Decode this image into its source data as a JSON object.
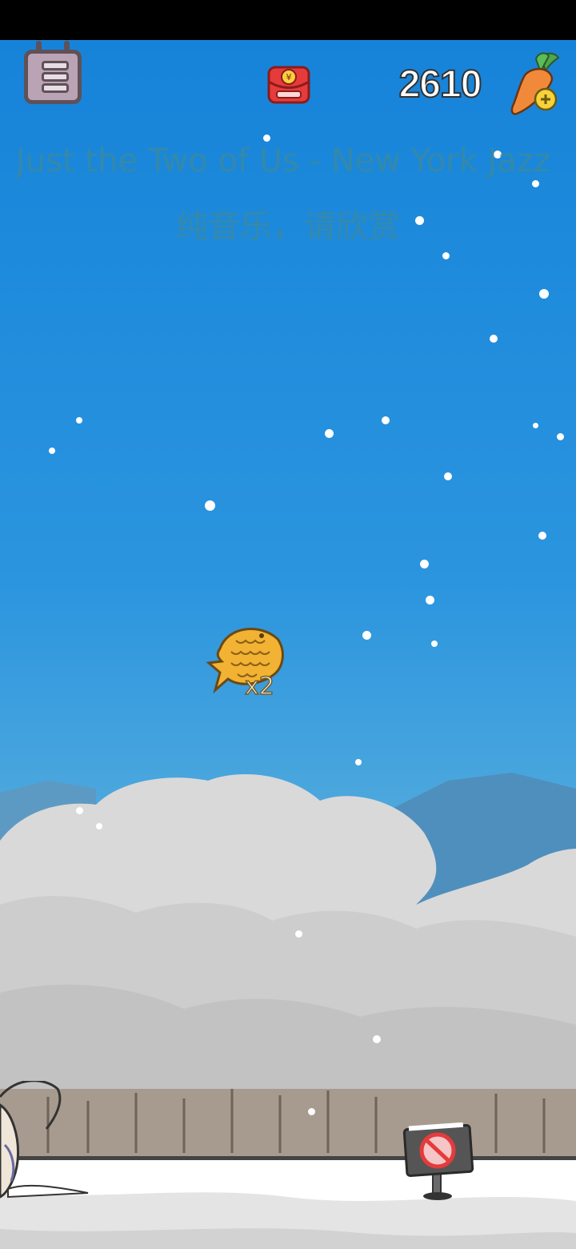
{
  "hud": {
    "menu_icon": "menu-icon",
    "red_envelope_icon": "red-envelope-icon",
    "red_envelope_symbol": "¥",
    "score": "2610",
    "carrot_icon": "carrot-add-icon"
  },
  "music": {
    "title": "Just the Two of Us - New York Jazz",
    "subtitle": "纯音乐，请欣赏"
  },
  "pickup": {
    "icon": "taiyaki-fish-icon",
    "multiplier": "x2"
  },
  "scene": {
    "sign_icon": "no-entry-sign-icon",
    "character_icon": "rabbit-character-icon"
  },
  "colors": {
    "sky_top": "#1683d9",
    "sky_bottom": "#7fbfe0",
    "accent_red": "#e63b3b",
    "fish_gold": "#f2b233"
  }
}
